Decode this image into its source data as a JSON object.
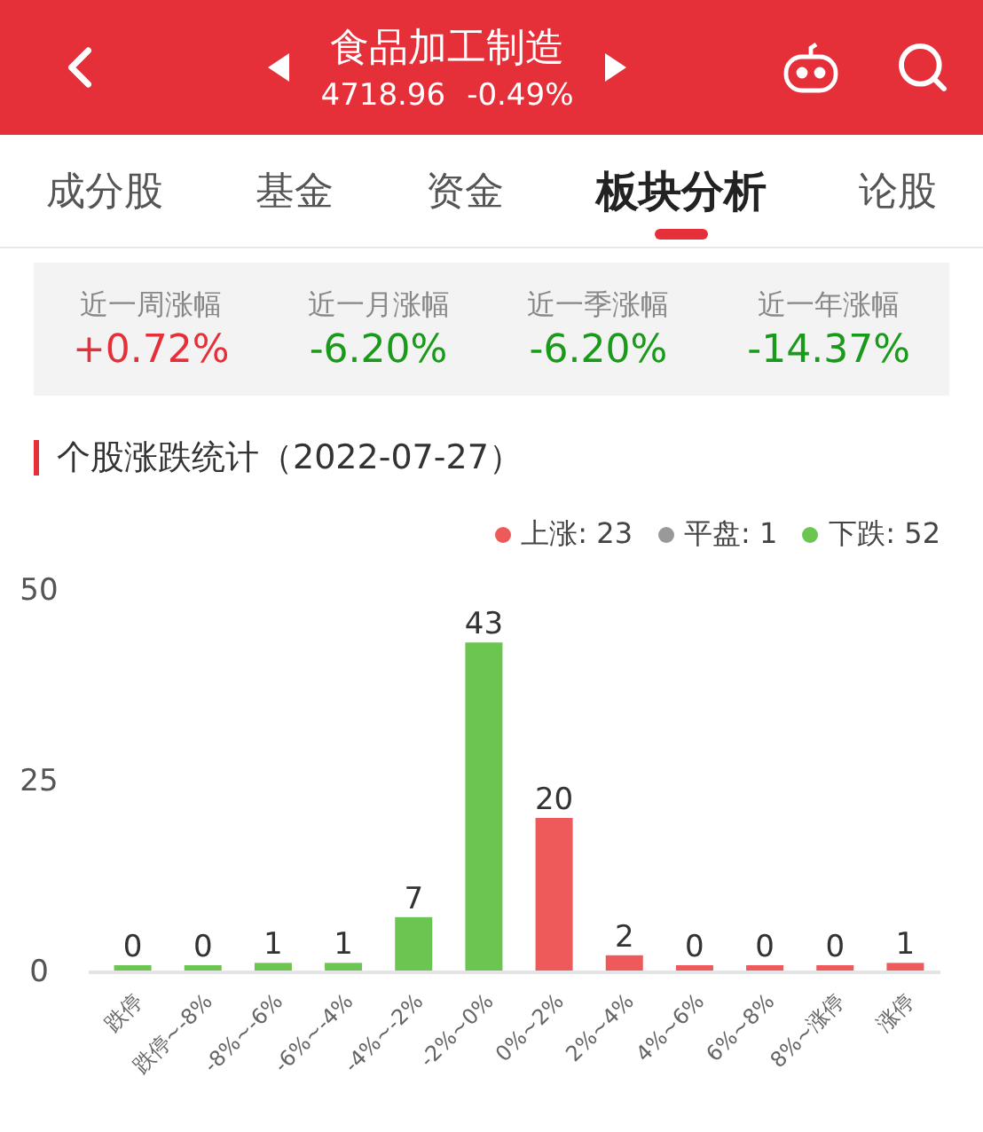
{
  "header": {
    "title": "食品加工制造",
    "price": "4718.96",
    "change": "-0.49%"
  },
  "tabs": [
    {
      "label": "成分股",
      "selected": false
    },
    {
      "label": "基金",
      "selected": false
    },
    {
      "label": "资金",
      "selected": false
    },
    {
      "label": "板块分析",
      "selected": true
    },
    {
      "label": "论股",
      "selected": false
    }
  ],
  "performance": [
    {
      "label": "近一周涨幅",
      "value": "+0.72%",
      "color": "#e5303a"
    },
    {
      "label": "近一月涨幅",
      "value": "-6.20%",
      "color": "#1a9a1a"
    },
    {
      "label": "近一季涨幅",
      "value": "-6.20%",
      "color": "#1a9a1a"
    },
    {
      "label": "近一年涨幅",
      "value": "-14.37%",
      "color": "#1a9a1a"
    }
  ],
  "section_title": "个股涨跌统计（2022-07-27）",
  "legend": [
    {
      "label": "上涨: 23",
      "color": "#ee5a5a"
    },
    {
      "label": "平盘: 1",
      "color": "#999999"
    },
    {
      "label": "下跌: 52",
      "color": "#6cc551"
    }
  ],
  "chart_data": {
    "type": "bar",
    "categories": [
      "跌停",
      "跌停~-8%",
      "-8%~-6%",
      "-6%~-4%",
      "-4%~-2%",
      "-2%~0%",
      "0%~2%",
      "2%~4%",
      "4%~6%",
      "6%~8%",
      "8%~涨停",
      "涨停"
    ],
    "series": [
      {
        "color": "#6cc551",
        "values": [
          0,
          0,
          1,
          1,
          7,
          43,
          null,
          null,
          null,
          null,
          null,
          null
        ]
      },
      {
        "color": "#ee5a5a",
        "values": [
          null,
          null,
          null,
          null,
          null,
          null,
          20,
          2,
          0,
          0,
          0,
          1
        ]
      }
    ],
    "ylim": [
      0,
      50
    ],
    "yticks": [
      0,
      25,
      50
    ],
    "data_labels": true
  }
}
